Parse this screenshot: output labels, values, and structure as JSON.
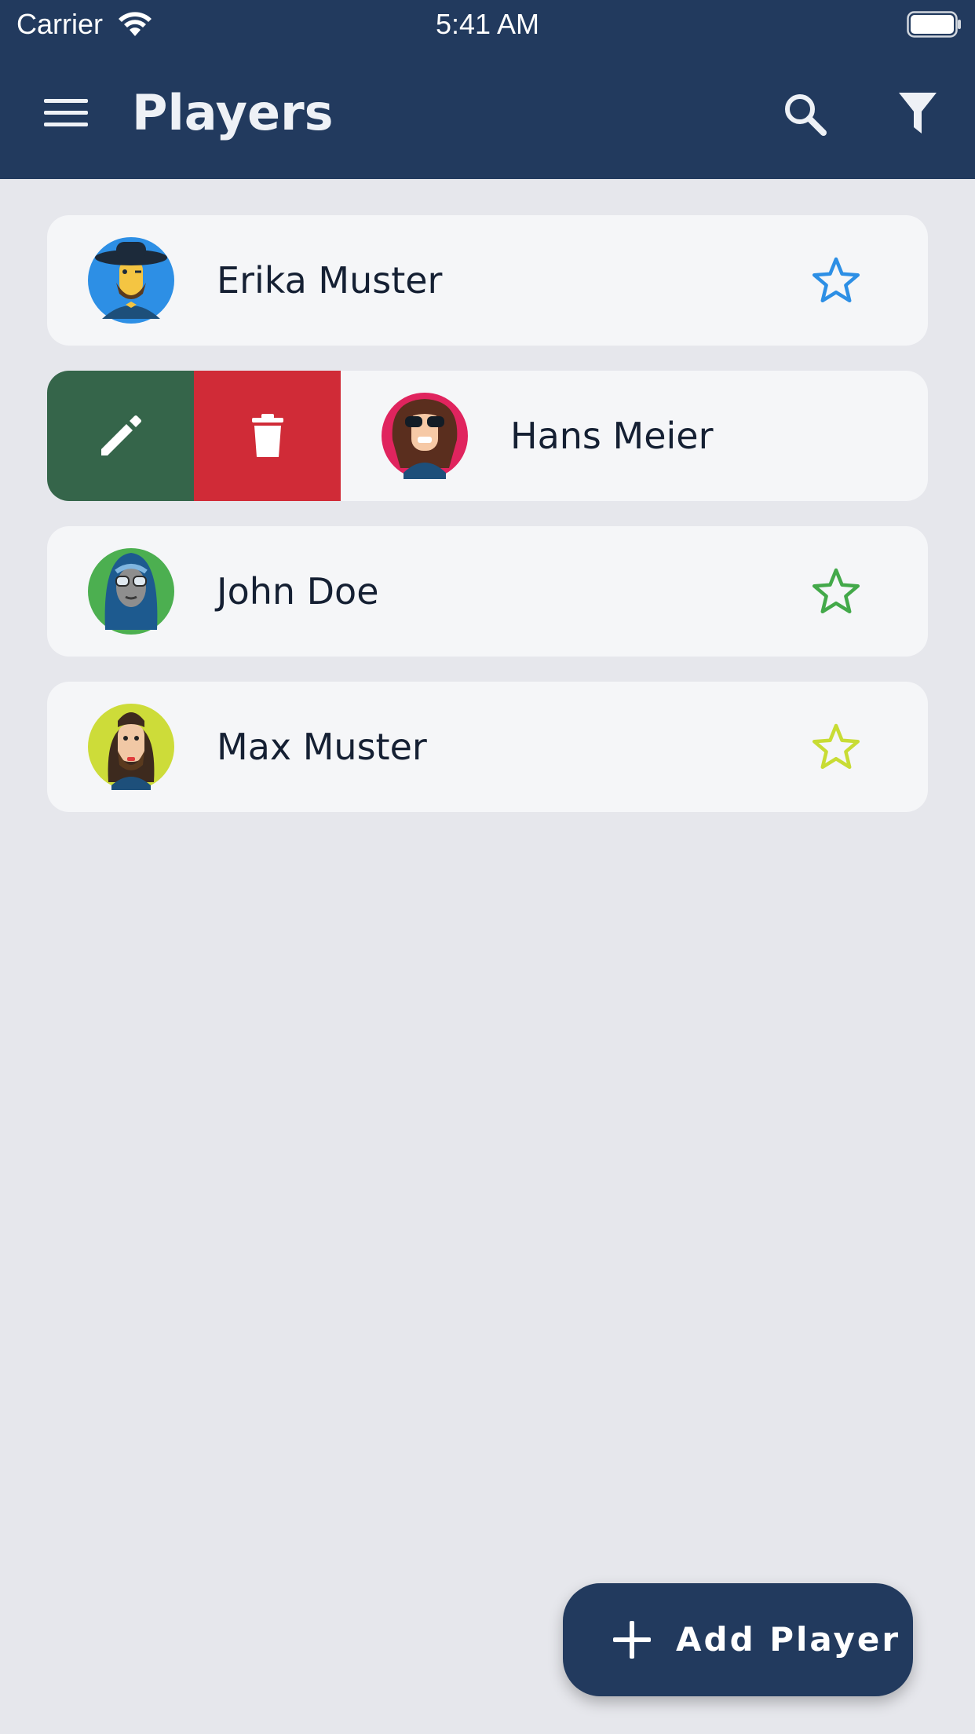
{
  "status_bar": {
    "carrier": "Carrier",
    "time": "5:41 AM"
  },
  "app_bar": {
    "title": "Players",
    "icons": [
      "menu-icon",
      "search-icon",
      "filter-icon"
    ]
  },
  "players": [
    {
      "name": "Erika Muster",
      "star_color": "#2d8fe5",
      "avatar_bg": "#2d8fe5"
    },
    {
      "name": "Hans Meier",
      "avatar_bg": "#e0245e",
      "swiped": true,
      "actions": [
        "edit",
        "delete"
      ]
    },
    {
      "name": "John Doe",
      "star_color": "#43a94a",
      "avatar_bg": "#4caf50"
    },
    {
      "name": "Max Muster",
      "star_color": "#c8dc34",
      "avatar_bg": "#cddc39"
    }
  ],
  "fab": {
    "label": "Add Player"
  },
  "colors": {
    "primary": "#223a5e",
    "background": "#e6e7ec",
    "card": "#f5f6f8",
    "edit_action": "#35654a",
    "delete_action": "#d02b37"
  }
}
